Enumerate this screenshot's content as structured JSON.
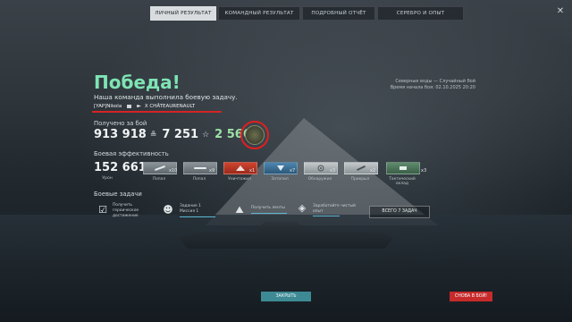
{
  "tabs": [
    {
      "label": "ЛИЧНЫЙ РЕЗУЛЬТАТ",
      "active": true
    },
    {
      "label": "КОМАНДНЫЙ РЕЗУЛЬТАТ",
      "active": false
    },
    {
      "label": "ПОДРОБНЫЙ ОТЧЁТ",
      "active": false
    },
    {
      "label": "СЕРЕБРО И ОПЫТ",
      "active": false
    }
  ],
  "header": {
    "result": "Победа!",
    "subtitle": "Наша команда выполнила боевую задачу.",
    "player": "[YAP]Nikola",
    "ship": "X CHÂTEAURENAULT"
  },
  "map_info": {
    "line1": "Северные воды — Случайный бой",
    "line2": "Время начала боя: 02.10.2025 20:20"
  },
  "received": {
    "label": "Получено за бой",
    "credits": "913 918",
    "xp": "7 251",
    "free_xp": "2 566",
    "credit_icon": "credits-icon",
    "xp_icon": "star-icon"
  },
  "efficiency": {
    "label": "Боевая эффективность",
    "damage": "152 661",
    "damage_label": "Урон",
    "ribbons": [
      {
        "label": "Попал",
        "count": "x10",
        "icon": "shell-hit-icon"
      },
      {
        "label": "Попал",
        "count": "x9",
        "icon": "torpedo-hit-icon"
      },
      {
        "label": "Уничтожил",
        "count": "x1",
        "icon": "destroyed-icon"
      },
      {
        "label": "Затопил",
        "count": "x7",
        "icon": "flood-icon"
      },
      {
        "label": "Обнаружил",
        "count": "x3",
        "icon": "spotted-icon"
      },
      {
        "label": "Прикрыл",
        "count": "x2",
        "icon": "shield-icon"
      },
      {
        "label": "Тактический вклад",
        "count": "x3",
        "icon": "tactical-icon"
      }
    ]
  },
  "tasks": {
    "label": "Боевые задачи",
    "items": [
      {
        "text1": "Получить",
        "text2": "героическое",
        "text3": "достижение",
        "icon": "check-icon"
      },
      {
        "text1": "Задание 1",
        "text2": "Миссия 1",
        "icon": "commander-icon"
      },
      {
        "text1": "Получить ленты",
        "icon": "ribbon-task-icon"
      },
      {
        "text1": "Заработайте чистый",
        "text2": "опыт",
        "icon": "diamond-icon"
      }
    ],
    "all_tasks": "ВСЕГО 7 ЗАДАЧ"
  },
  "buttons": {
    "close": "ЗАКРЫТЬ",
    "again": "СНОВА В БОЙ!"
  },
  "colors": {
    "victory": "#7ee4b4",
    "accent_red": "#e01f1f",
    "close_btn": "#3d8a95",
    "again_btn": "#c72a2a"
  }
}
